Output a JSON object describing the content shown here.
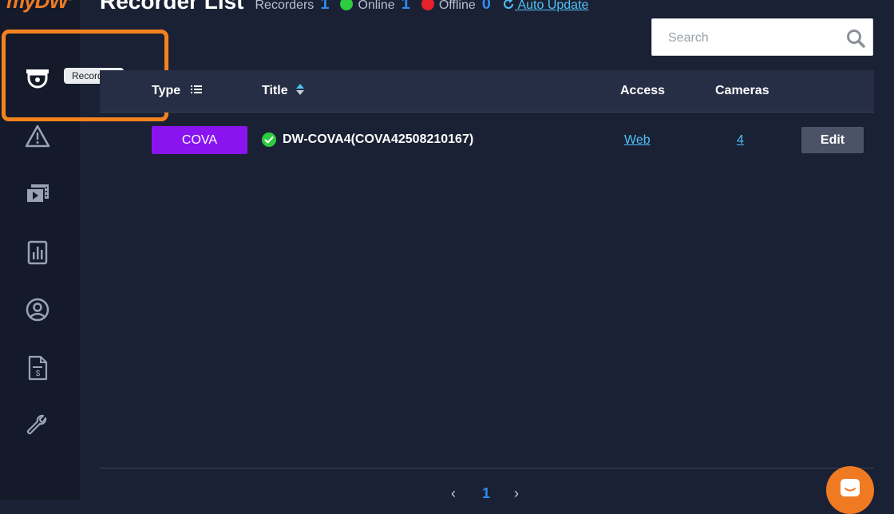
{
  "brand": {
    "logo_text": "myDW",
    "logo_mark": "®"
  },
  "header": {
    "title": "Recorder List",
    "recorders_label": "Recorders",
    "recorders_count": "1",
    "online_label": "Online",
    "online_count": "1",
    "offline_label": "Offline",
    "offline_count": "0",
    "auto_update_label": "Auto Update"
  },
  "search": {
    "placeholder": "Search"
  },
  "sidebar": {
    "tooltip": "Recorders",
    "items": [
      {
        "icon": "camera-dome-icon"
      },
      {
        "icon": "warning-icon"
      },
      {
        "icon": "video-library-icon"
      },
      {
        "icon": "reports-icon"
      },
      {
        "icon": "account-icon"
      },
      {
        "icon": "billing-icon"
      },
      {
        "icon": "wrench-icon"
      }
    ]
  },
  "table": {
    "columns": {
      "type": "Type",
      "title": "Title",
      "access": "Access",
      "cameras": "Cameras"
    },
    "rows": [
      {
        "type": "COVA",
        "status": "online",
        "title": "DW-COVA4(COVA42508210167)",
        "access": "Web",
        "cameras": "4",
        "action": "Edit"
      }
    ]
  },
  "pagination": {
    "prev": "‹",
    "current": "1",
    "next": "›"
  },
  "colors": {
    "accent_orange": "#f4821f",
    "badge_purple": "#8a14f0",
    "online_green": "#2ecc40",
    "offline_red": "#e8202a",
    "link_blue": "#4fc3f7"
  }
}
